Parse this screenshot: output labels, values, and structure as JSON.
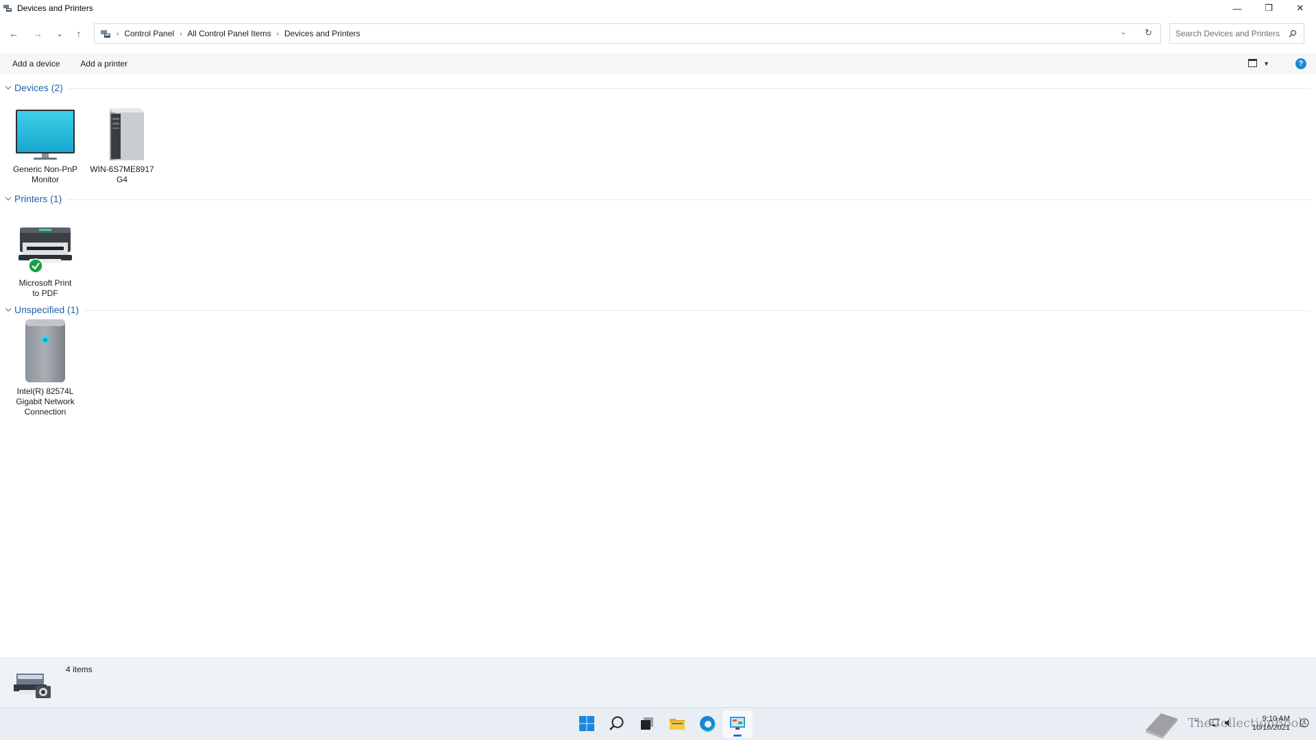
{
  "window": {
    "title": "Devices and Printers",
    "controls": {
      "minimize": "—",
      "maximize": "❐",
      "close": "✕"
    }
  },
  "nav": {
    "back": "←",
    "forward": "→",
    "recent": "⌄",
    "up": "↑",
    "breadcrumb": [
      "Control Panel",
      "All Control Panel Items",
      "Devices and Printers"
    ],
    "search_placeholder": "Search Devices and Printers"
  },
  "commands": {
    "add_device": "Add a device",
    "add_printer": "Add a printer",
    "help": "?"
  },
  "groups": {
    "devices": {
      "title": "Devices (2)",
      "items": [
        {
          "label_line1": "Generic Non-PnP",
          "label_line2": "Monitor",
          "icon": "monitor-icon"
        },
        {
          "label_line1": "WIN-6S7ME8917",
          "label_line2": "G4",
          "icon": "computer-tower-icon"
        }
      ]
    },
    "printers": {
      "title": "Printers (1)",
      "items": [
        {
          "label_line1": "Microsoft Print",
          "label_line2": "to PDF",
          "icon": "printer-icon",
          "status_icon": "default-check-icon"
        }
      ]
    },
    "unspecified": {
      "title": "Unspecified (1)",
      "items": [
        {
          "label_line1": "Intel(R) 82574L",
          "label_line2": "Gigabit Network",
          "label_line3": "Connection",
          "icon": "network-device-icon"
        }
      ]
    }
  },
  "status": {
    "item_count": "4 items",
    "icon": "devices-and-printers-icon"
  },
  "taskbar": {
    "apps": [
      "start-icon",
      "search-icon",
      "task-view-icon",
      "file-explorer-icon",
      "edge-icon",
      "control-panel-icon"
    ],
    "time": "9:10 AM",
    "date": "10/16/2021"
  },
  "watermark": {
    "text": "TheCollectionBook"
  },
  "colors": {
    "group_title": "#1e5fa8",
    "accent": "#1f6fd1",
    "status_bg": "#eef3f8",
    "taskbar_bg": "#e9eef4"
  }
}
